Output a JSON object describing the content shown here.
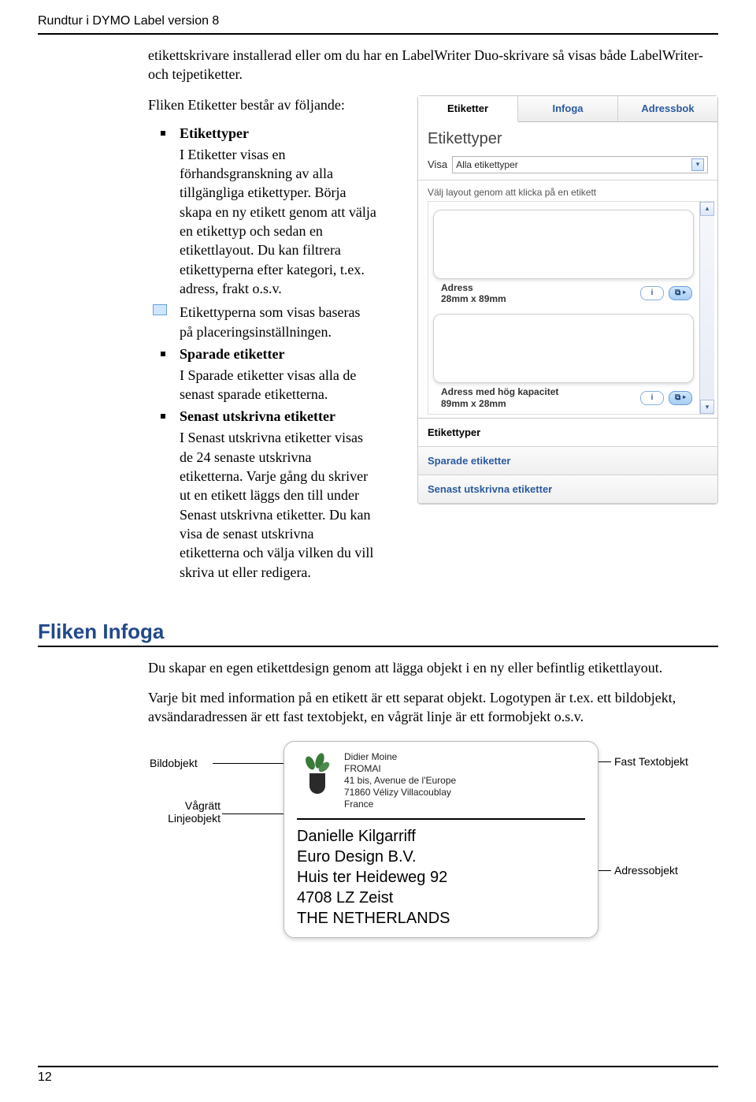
{
  "header": {
    "running_title": "Rundtur i DYMO Label version 8"
  },
  "intro": {
    "paragraph": "etikettskrivare installerad eller om du har en LabelWriter Duo-skrivare så visas både LabelWriter- och tejpetiketter.",
    "subhead": "Fliken Etiketter består av följande:"
  },
  "bullets": {
    "b1_title": "Etikettyper",
    "b1_text": "I Etiketter visas en förhandsgranskning av alla tillgängliga etikettyper. Börja skapa en ny etikett genom att välja en etikettyp och sedan en etikettlayout. Du kan filtrera etikettyperna efter kategori, t.ex. adress, frakt o.s.v.",
    "note": "Etikettyperna som visas baseras på placeringsinställningen.",
    "b2_title": "Sparade etiketter",
    "b2_text": "I Sparade etiketter visas alla de senast sparade etiketterna.",
    "b3_title": "Senast utskrivna etiketter",
    "b3_text": "I Senast utskrivna etiketter visas de 24 senaste utskrivna etiketterna. Varje gång du skriver ut en etikett läggs den till under Senast utskrivna etiketter. Du kan visa de senast utskrivna etiketterna och välja vilken du vill skriva ut eller redigera."
  },
  "ui": {
    "tabs": {
      "etiketter": "Etiketter",
      "infoga": "Infoga",
      "adressbok": "Adressbok"
    },
    "section_title": "Etikettyper",
    "visa_label": "Visa",
    "visa_value": "Alla etikettyper",
    "hint": "Välj layout genom att klicka på en etikett",
    "cards": [
      {
        "line1": "Adress",
        "line2": "28mm x 89mm"
      },
      {
        "line1": "Adress med hög kapacitet",
        "line2": "89mm x 28mm"
      }
    ],
    "info_glyph": "i",
    "dup_glyph": "⧉ ▸",
    "bottom": {
      "etikettyper": "Etikettyper",
      "sparade": "Sparade etiketter",
      "senast": "Senast utskrivna etiketter"
    }
  },
  "section2": {
    "heading": "Fliken Infoga",
    "p1": "Du skapar en egen etikettdesign genom att lägga objekt i en ny eller befintlig etikettlayout.",
    "p2": "Varje bit med information på en etikett är ett separat objekt. Logotypen är t.ex. ett bildobjekt, avsändaradressen är ett fast textobjekt, en vågrät linje är ett formobjekt o.s.v."
  },
  "figure": {
    "callout_image": "Bildobjekt",
    "callout_line": "Vågrätt\nLinjeobjekt",
    "callout_fasttext": "Fast Textobjekt",
    "callout_address": "Adressobjekt",
    "small_text": "Didier Moine\nFROMAI\n41 bis, Avenue de l'Europe\n71860 Vélizy Villacoublay\nFrance",
    "big_text": "Danielle Kilgarriff\nEuro Design B.V.\nHuis ter Heideweg 92\n4708 LZ Zeist\nTHE NETHERLANDS"
  },
  "page_number": "12"
}
